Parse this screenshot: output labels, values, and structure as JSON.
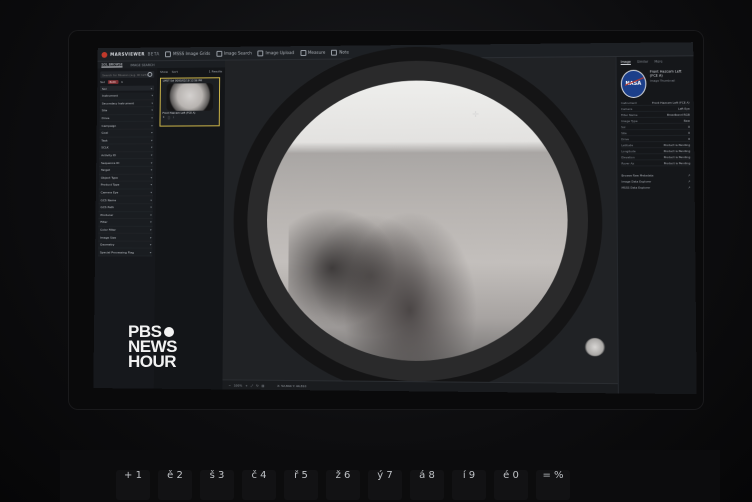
{
  "app": {
    "brand": "MARSVIEWER",
    "beta": "BETA",
    "nav": [
      "MSSS Image Grids",
      "Image Search",
      "Image Upload",
      "Measure",
      "Note"
    ]
  },
  "subtabs": [
    "SOL BROWSE",
    "IMAGE SEARCH"
  ],
  "search": {
    "placeholder": "Search for Mission (e.g. ID 123)"
  },
  "chips": {
    "one": "Sol",
    "two": "Both",
    "count": "1"
  },
  "selected": {
    "value": "Sol"
  },
  "filters": [
    "Instrument",
    "Secondary Instrument",
    "Site",
    "Drive",
    "Campaign",
    "Goal",
    "Task",
    "SCLK",
    "Activity ID",
    "Sequence ID",
    "Target",
    "Object Type",
    "Product Type",
    "Camera Eye",
    "GCS Name",
    "GCS Path",
    "Producer",
    "Filter",
    "Color Filter",
    "Image Size",
    "Geometry",
    "Special Processing Flag"
  ],
  "thumb": {
    "head_show": "Show",
    "head_sort": "Sort",
    "count": "1 Results",
    "caption_top": "LMST Sol 0000/02/18 12:56 PM",
    "caption_bottom": "Front Hazcam Left (FCE A)"
  },
  "viewer": {
    "zoom": "100%",
    "coord": "X: 52,844 Y: 44,810"
  },
  "right": {
    "tabs": [
      "Image",
      "Similar",
      "More"
    ],
    "title": "Front Hazcam Left (FCE A)",
    "agency": "NASA",
    "caption": "Image Thumbnail",
    "meta": [
      [
        "Instrument",
        "Front Hazcam Left (FCE A)"
      ],
      [
        "Camera",
        "Left Eye"
      ],
      [
        "Filter Name",
        "Broadband RGB"
      ],
      [
        "Image Type",
        "Raw"
      ],
      [
        "Sol",
        "0"
      ],
      [
        "Site",
        "0"
      ],
      [
        "Drive",
        "0"
      ],
      [
        "Latitude",
        "Product is Pending"
      ],
      [
        "Longitude",
        "Product is Pending"
      ],
      [
        "Elevation",
        "Product is Pending"
      ],
      [
        "Rover Az",
        "Product is Pending"
      ]
    ],
    "links": [
      "Browse Raw Metadata",
      "Image Data Explorer",
      "MSSS Data Explorer"
    ]
  },
  "watermark": {
    "line1": "PBS",
    "line2": "NEWS",
    "line3": "HOUR"
  },
  "keyboard": [
    "+ 1",
    "ě 2",
    "š 3",
    "č 4",
    "ř 5",
    "ž 6",
    "ý 7",
    "á 8",
    "í 9",
    "é 0",
    "= %"
  ]
}
